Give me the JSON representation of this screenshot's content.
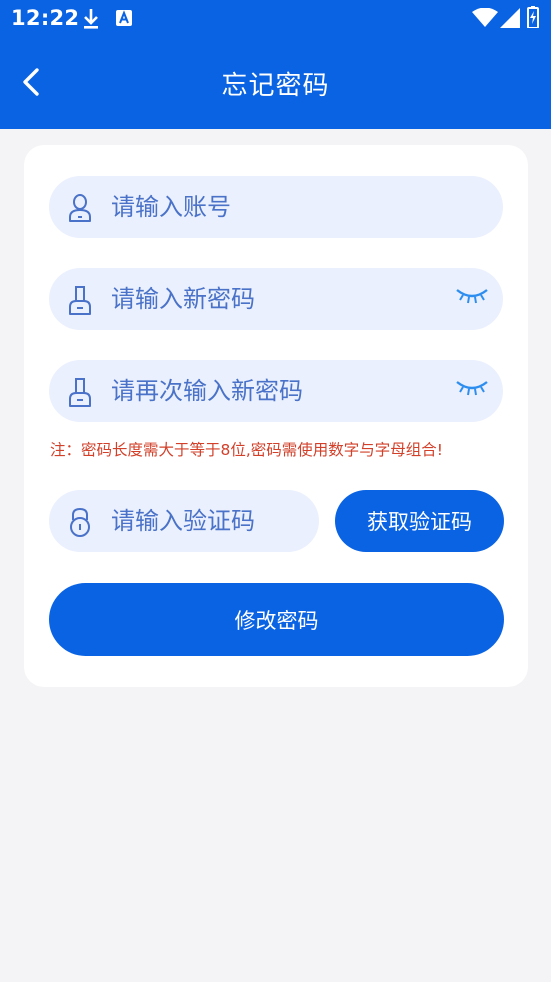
{
  "status_bar": {
    "time": "12:22",
    "icons": [
      "download-icon",
      "app-notification-icon",
      "wifi-icon",
      "signal-icon",
      "battery-icon"
    ]
  },
  "header": {
    "title": "忘记密码",
    "back_icon": "chevron-left-icon"
  },
  "form": {
    "account": {
      "placeholder": "请输入账号",
      "icon": "user-icon"
    },
    "new_password": {
      "placeholder": "请输入新密码",
      "icon": "key-icon",
      "toggle_icon": "eye-closed-icon"
    },
    "confirm_password": {
      "placeholder": "请再次输入新密码",
      "icon": "key-icon",
      "toggle_icon": "eye-closed-icon"
    },
    "note": "注：密码长度需大于等于8位,密码需使用数字与字母组合!",
    "verification_code": {
      "placeholder": "请输入验证码",
      "icon": "lock-icon"
    },
    "get_code_label": "获取验证码",
    "submit_label": "修改密码"
  },
  "colors": {
    "primary": "#0a63e3",
    "input_bg": "#eaf0fd",
    "placeholder": "#4a72c8",
    "note": "#d2402a",
    "page_bg": "#f4f4f6"
  }
}
